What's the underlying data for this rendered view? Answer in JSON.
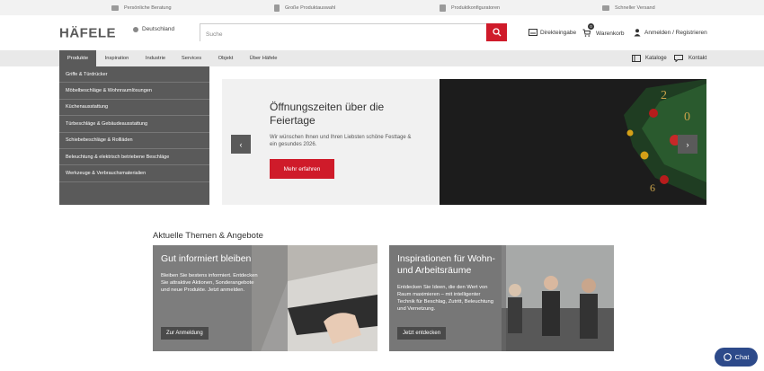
{
  "topbar": {
    "items": [
      {
        "label": "Persönliche Beratung",
        "icon": "handshake-icon"
      },
      {
        "label": "Große Produktauswahl",
        "icon": "catalog-icon"
      },
      {
        "label": "Produktkonfiguratoren",
        "icon": "configurator-icon"
      },
      {
        "label": "Schneller Versand",
        "icon": "truck-icon"
      }
    ]
  },
  "header": {
    "logo_text": "HÄFELE",
    "region": "Deutschland",
    "search_placeholder": "Suche",
    "direct_entry": "Direkteingabe",
    "cart_label": "Warenkorb",
    "cart_count": "0",
    "login": "Anmelden / Registrieren"
  },
  "nav": {
    "items": [
      "Produkte",
      "Inspiration",
      "Industrie",
      "Services",
      "Objekt",
      "Über Häfele"
    ],
    "catalogs": "Kataloge",
    "contact": "Kontakt"
  },
  "dropdown": {
    "items": [
      "Griffe & Türdrücker",
      "Möbelbeschläge & Wohnraumlösungen",
      "Küchenausstattung",
      "Türbeschläge & Gebäudeausstattung",
      "Schiebebeschläge & Rollläden",
      "Beleuchtung & elektrisch betriebene Beschläge",
      "Werkzeuge & Verbrauchsmaterialien"
    ]
  },
  "hero": {
    "title": "Öffnungszeiten über die Feiertage",
    "text": "Wir wünschen Ihnen und Ihren Liebsten schöne Festtage & ein gesundes 2026.",
    "button": "Mehr erfahren"
  },
  "section": {
    "title": "Aktuelle Themen & Angebote"
  },
  "cards": [
    {
      "title": "Gut informiert bleiben",
      "text": "Bleiben Sie bestens informiert. Entdecken Sie attraktive Aktionen, Sonderangebote und neue Produkte. Jetzt anmelden.",
      "button": "Zur Anmeldung"
    },
    {
      "title": "Inspirationen für Wohn- und Arbeitsräume",
      "text": "Entdecken Sie Ideen, die den Wert von Raum maximieren – mit intelligenter Technik für Beschlag, Zutritt, Beleuchtung und Vernetzung.",
      "button": "Jetzt entdecken"
    }
  ],
  "chat": {
    "label": "Chat"
  },
  "colors": {
    "brand_red": "#cf1b2a",
    "nav_dark": "#5a5a5a",
    "chat_blue": "#2d4a8a"
  }
}
